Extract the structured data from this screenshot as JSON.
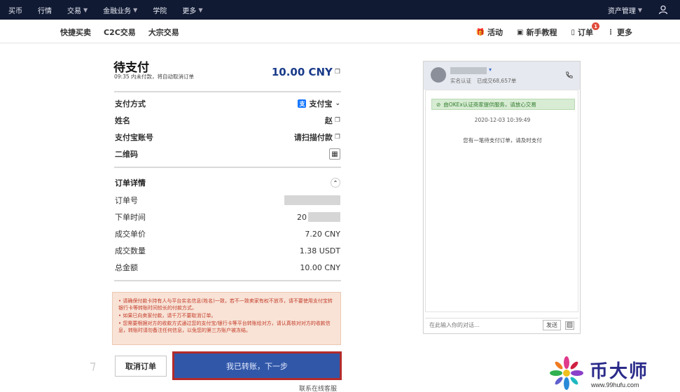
{
  "topnav": {
    "items": [
      {
        "label": "买币",
        "chevron": false
      },
      {
        "label": "行情",
        "chevron": false
      },
      {
        "label": "交易",
        "chevron": true
      },
      {
        "label": "金融业务",
        "chevron": true
      },
      {
        "label": "学院",
        "chevron": false
      },
      {
        "label": "更多",
        "chevron": true
      }
    ],
    "asset_label": "资产管理"
  },
  "subnav": {
    "tabs": [
      "快捷买卖",
      "C2C交易",
      "大宗交易"
    ],
    "activity": "活动",
    "tutorial": "新手教程",
    "orders": "订单",
    "orders_badge": "1",
    "more": "更多"
  },
  "payment": {
    "title": "待支付",
    "subtitle": "09:35 内未付款，将自动取消订单",
    "amount": "10.00 CNY",
    "method_label": "支付方式",
    "method_value": "支付宝",
    "name_label": "姓名",
    "name_value": "赵",
    "account_label": "支付宝账号",
    "account_value": "请扫描付款",
    "qr_label": "二维码"
  },
  "details": {
    "title": "订单详情",
    "order_no_label": "订单号",
    "time_label": "下单时间",
    "time_prefix": "20",
    "price_label": "成交单价",
    "price_value": "7.20 CNY",
    "qty_label": "成交数量",
    "qty_value": "1.38 USDT",
    "total_label": "总金额",
    "total_value": "10.00 CNY"
  },
  "notice": {
    "lines": [
      "• 请确保付款卡持有人与平台实名信息(姓名)一致，若不一致卖家有权不放币，请不要使用支付宝转银行卡等转账时间较长的付款方式。",
      "• 如果已向卖家付款，请千万不要取消订单。",
      "• 您需要根据对方的收款方式通过您的支付宝/银行卡等平台转账给对方，请认真核对对方的收款信息，转账时请勿备注任何信息，以免您的第三方账户被冻结。"
    ]
  },
  "actions": {
    "cancel": "取消订单",
    "next": "我已转账，下一步",
    "contact": "联系在线客服"
  },
  "chat": {
    "verified": "实名认证",
    "deals": "已成交68,657单",
    "safe_banner": "由OKEx认证商家提供服务，请放心交易",
    "time": "2020-12-03 10:39:49",
    "message": "您有一笔待支付订单，请及时支付",
    "input_placeholder": "在此输入你的对话…",
    "send": "发送"
  },
  "watermark": {
    "cn": "币大师",
    "url": "www.99hufu.com"
  },
  "colors": {
    "topnav_bg": "#111a33",
    "primary": "#3157a8",
    "highlight_border": "#b32b2b",
    "notice_text": "#c43c2a",
    "safe_green": "#2f7a2b"
  }
}
